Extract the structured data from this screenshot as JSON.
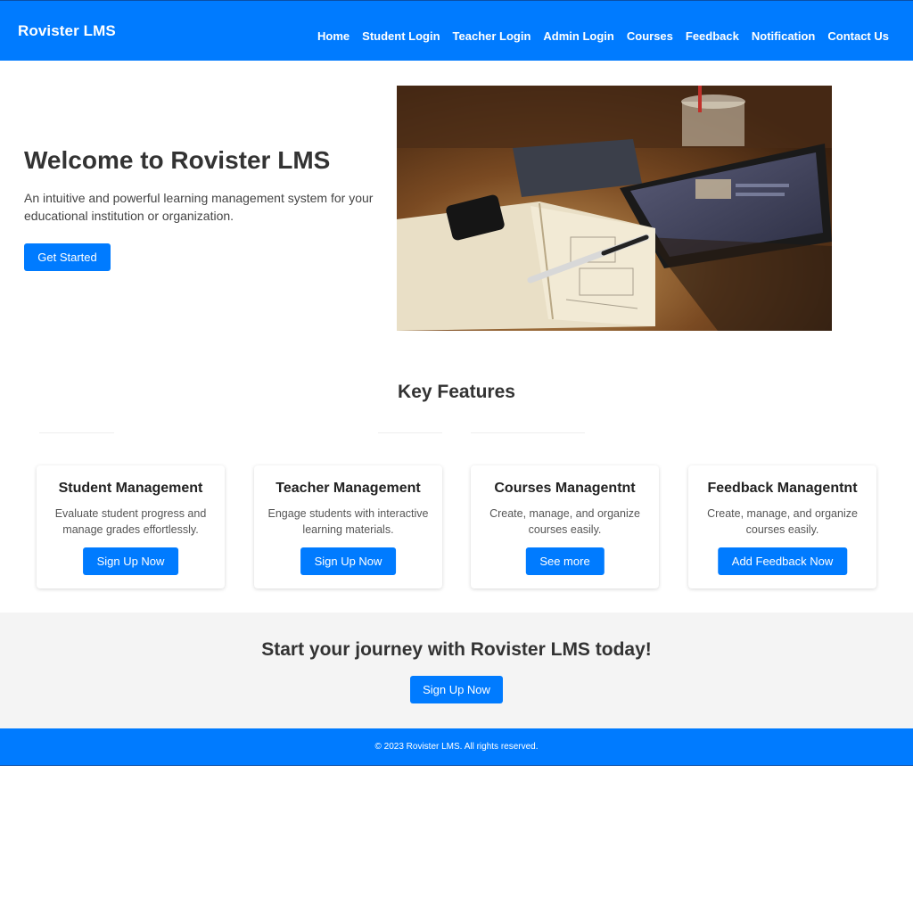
{
  "header": {
    "brand": "Rovister LMS",
    "nav": [
      "Home",
      "Student Login",
      "Teacher Login",
      "Admin Login",
      "Courses",
      "Feedback",
      "Notification",
      "Contact Us"
    ]
  },
  "hero": {
    "title": "Welcome to Rovister LMS",
    "description": "An intuitive and powerful learning management system for your educational institution or organization.",
    "button": "Get Started",
    "image": "desk-study-photo"
  },
  "features": {
    "title": "Key Features",
    "cards": [
      {
        "title": "Student Management",
        "text": "Evaluate student progress and manage grades effortlessly.",
        "button": "Sign Up Now"
      },
      {
        "title": "Teacher Management",
        "text": "Engage students with interactive learning materials.",
        "button": "Sign Up Now"
      },
      {
        "title": "Courses Managentnt",
        "text": "Create, manage, and organize courses easily.",
        "button": "See more"
      },
      {
        "title": "Feedback Managentnt",
        "text": "Create, manage, and organize courses easily.",
        "button": "Add Feedback Now"
      }
    ]
  },
  "cta": {
    "title": "Start your journey with Rovister LMS today!",
    "button": "Sign Up Now"
  },
  "footer": {
    "text": "© 2023 Rovister LMS. All rights reserved."
  },
  "colors": {
    "primary": "#007bff",
    "cta_background": "#f4f4f4",
    "text": "#333333"
  }
}
